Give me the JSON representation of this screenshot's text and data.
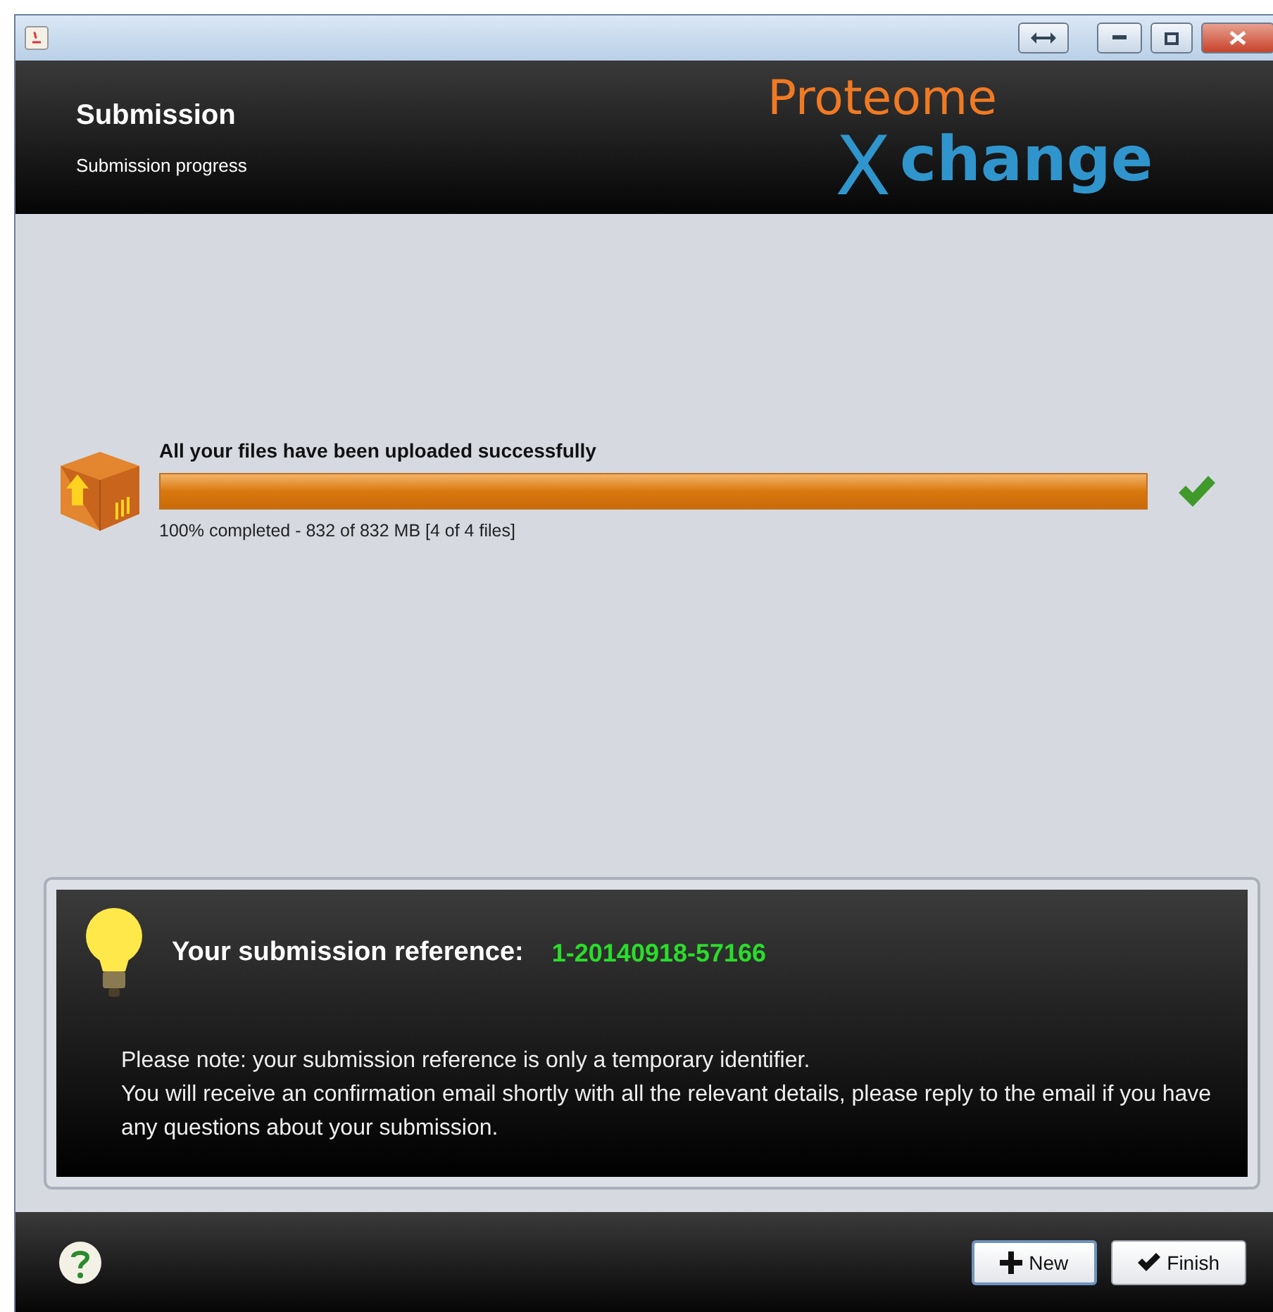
{
  "header": {
    "title": "Submission",
    "subtitle": "Submission progress"
  },
  "logo": {
    "top": "Proteome",
    "big_letter": "X",
    "rest": "change"
  },
  "upload": {
    "title": "All your files have been uploaded successfully",
    "level": 1.0,
    "status": "100% completed - 832 of 832 MB [4 of 4 files]",
    "done": true
  },
  "reference": {
    "label": "Your submission reference:",
    "value": "1-20140918-57166"
  },
  "notes": [
    "Please note: your submission reference is only a temporary identifier.",
    "You will receive an confirmation email shortly with all the relevant details, please reply to the email if you have any questions about your submission."
  ],
  "buttons": [
    {
      "label": "New",
      "kind": "new",
      "focused": true
    },
    {
      "label": "Finish",
      "kind": "finish",
      "focused": false
    }
  ]
}
